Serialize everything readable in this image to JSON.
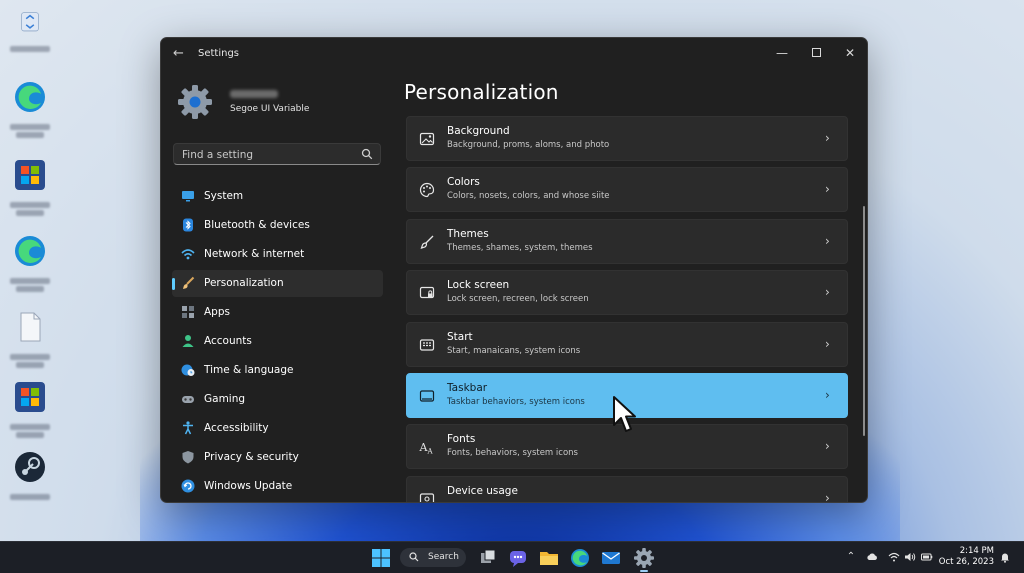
{
  "window": {
    "title": "Settings",
    "profile_subtitle": "Segoe UI Variable"
  },
  "search": {
    "placeholder": "Find a setting"
  },
  "nav": [
    {
      "label": "System",
      "icon": "monitor-icon"
    },
    {
      "label": "Bluetooth & devices",
      "icon": "bluetooth-icon"
    },
    {
      "label": "Network & internet",
      "icon": "wifi-icon"
    },
    {
      "label": "Personalization",
      "icon": "brush-icon"
    },
    {
      "label": "Apps",
      "icon": "apps-icon"
    },
    {
      "label": "Accounts",
      "icon": "person-icon"
    },
    {
      "label": "Time & language",
      "icon": "globe-clock-icon"
    },
    {
      "label": "Gaming",
      "icon": "gamepad-icon"
    },
    {
      "label": "Accessibility",
      "icon": "accessibility-icon"
    },
    {
      "label": "Privacy & security",
      "icon": "shield-icon"
    },
    {
      "label": "Windows Update",
      "icon": "update-icon"
    }
  ],
  "main": {
    "title": "Personalization",
    "cards": [
      {
        "title": "Background",
        "subtitle": "Background, proms, aloms, and photo",
        "icon": "image-icon"
      },
      {
        "title": "Colors",
        "subtitle": "Colors, nosets, colors, and whose siite",
        "icon": "palette-icon"
      },
      {
        "title": "Themes",
        "subtitle": "Themes, shames, system, themes",
        "icon": "brush-icon"
      },
      {
        "title": "Lock screen",
        "subtitle": "Lock screen, recreen, lock screen",
        "icon": "lock-screen-icon"
      },
      {
        "title": "Start",
        "subtitle": "Start, manaicans, system icons",
        "icon": "start-grid-icon"
      },
      {
        "title": "Taskbar",
        "subtitle": "Taskbar behaviors, system icons",
        "icon": "taskbar-icon"
      },
      {
        "title": "Fonts",
        "subtitle": "Fonts, behaviors, system icons",
        "icon": "fonts-icon"
      },
      {
        "title": "Device usage",
        "subtitle": "",
        "icon": "device-usage-icon"
      }
    ]
  },
  "taskbar": {
    "search_label": "Search",
    "time": "2:14 PM",
    "date": "Oct 26, 2023"
  },
  "colors": {
    "accent": "#60cdff",
    "selected_card": "#5fbef0",
    "window_bg": "#202020",
    "card_bg": "#2b2b2b"
  }
}
